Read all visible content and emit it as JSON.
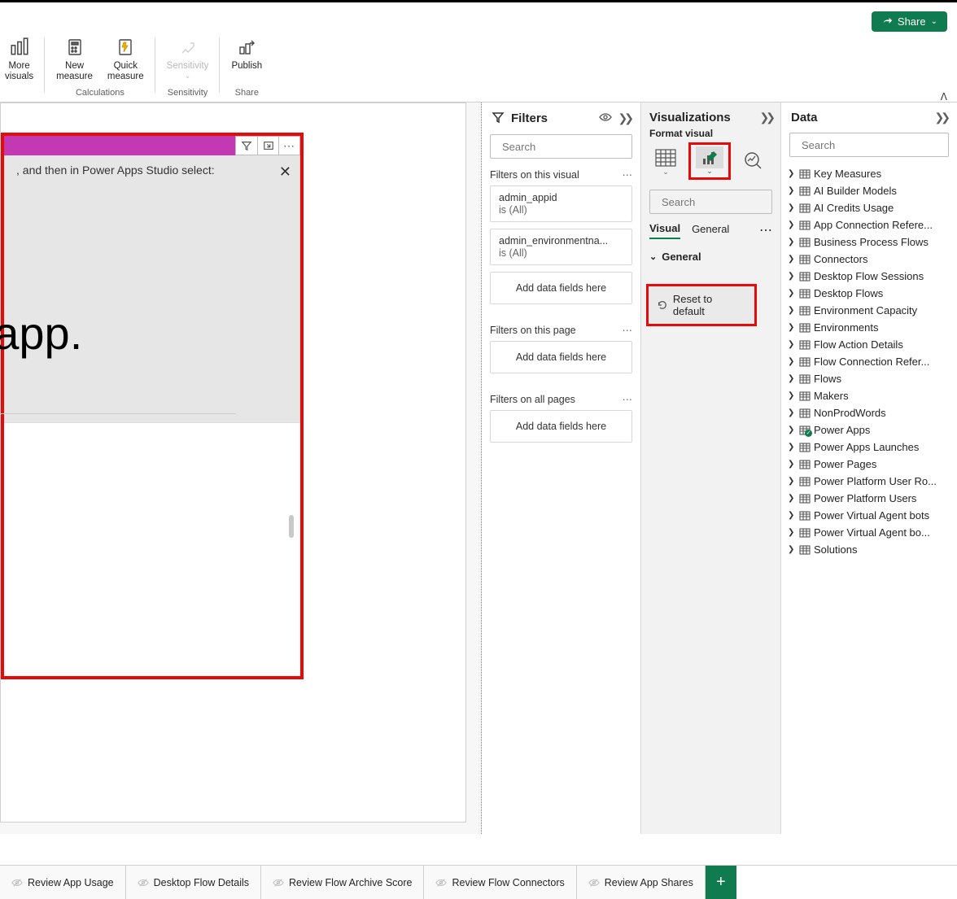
{
  "topbar": {
    "share_label": "Share"
  },
  "ribbon": {
    "more_visuals": "More\nvisuals",
    "new_measure": "New\nmeasure",
    "quick_measure": "Quick\nmeasure",
    "sensitivity": "Sensitivity",
    "publish": "Publish",
    "cat_calculations": "Calculations",
    "cat_sensitivity": "Sensitivity",
    "cat_share": "Share"
  },
  "visual": {
    "message": ", and then in Power Apps Studio select:",
    "big_text": "at app."
  },
  "filters": {
    "title": "Filters",
    "search_placeholder": "Search",
    "sec_visual": "Filters on this visual",
    "sec_page": "Filters on this page",
    "sec_all": "Filters on all pages",
    "card_appid": {
      "title": "admin_appid",
      "sub": "is (All)"
    },
    "card_env": {
      "title": "admin_environmentna...",
      "sub": "is (All)"
    },
    "add_placeholder": "Add data fields here"
  },
  "viz": {
    "title": "Visualizations",
    "subtitle": "Format visual",
    "search_placeholder": "Search",
    "tab_visual": "Visual",
    "tab_general": "General",
    "section_general": "General",
    "reset_label": "Reset to default"
  },
  "data": {
    "title": "Data",
    "search_placeholder": "Search",
    "tables": [
      "Key Measures",
      "AI Builder Models",
      "AI Credits Usage",
      "App Connection Refere...",
      "Business Process Flows",
      "Connectors",
      "Desktop Flow Sessions",
      "Desktop Flows",
      "Environment Capacity",
      "Environments",
      "Flow Action Details",
      "Flow Connection Refer...",
      "Flows",
      "Makers",
      "NonProdWords",
      "Power Apps",
      "Power Apps Launches",
      "Power Pages",
      "Power Platform User Ro...",
      "Power Platform Users",
      "Power Virtual Agent bots",
      "Power Virtual Agent bo...",
      "Solutions"
    ],
    "badge_index": 15
  },
  "tabs": [
    "Review App Usage",
    "Desktop Flow Details",
    "Review Flow Archive Score",
    "Review Flow Connectors",
    "Review App Shares"
  ]
}
